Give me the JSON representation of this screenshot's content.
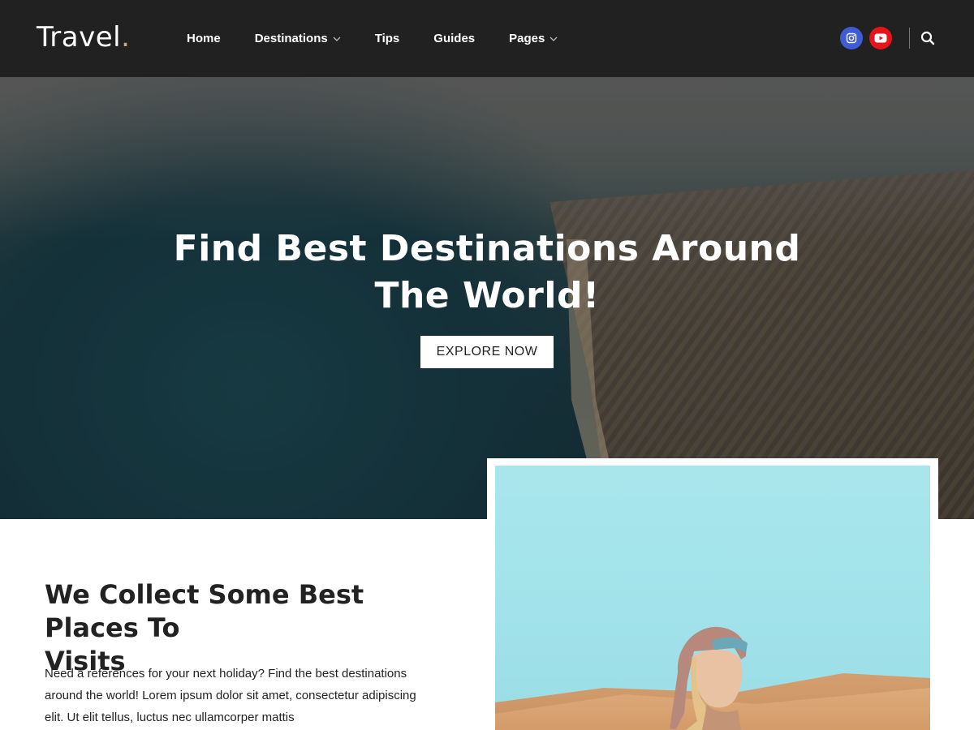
{
  "header": {
    "logo_text": "Travel",
    "logo_dot": ".",
    "nav": [
      {
        "label": "Home",
        "has_dropdown": false
      },
      {
        "label": "Destinations",
        "has_dropdown": true
      },
      {
        "label": "Tips",
        "has_dropdown": false
      },
      {
        "label": "Guides",
        "has_dropdown": false
      },
      {
        "label": "Pages",
        "has_dropdown": true
      }
    ],
    "social": [
      {
        "name": "instagram-icon",
        "color": "#3f5bd6"
      },
      {
        "name": "youtube-icon",
        "color": "#e8141a"
      }
    ],
    "search_icon": "search-icon"
  },
  "hero": {
    "title_line1": "Find Best Destinations Around",
    "title_line2": "The World!",
    "cta_label": "EXPLORE NOW"
  },
  "intro": {
    "title_line1": "We Collect Some Best Places To",
    "title_line2": "Visits",
    "text_line1": "Need a references for your next holiday? Find the best destinations",
    "text_line2": "around the world! Lorem ipsum dolor sit amet, consectetur adipiscing",
    "text_line3": "elit. Ut elit tellus, luctus nec ullamcorper mattis"
  },
  "colors": {
    "header_bg": "#212121",
    "logo_dot": "#e2a36a",
    "button_bg": "#ffffff"
  }
}
